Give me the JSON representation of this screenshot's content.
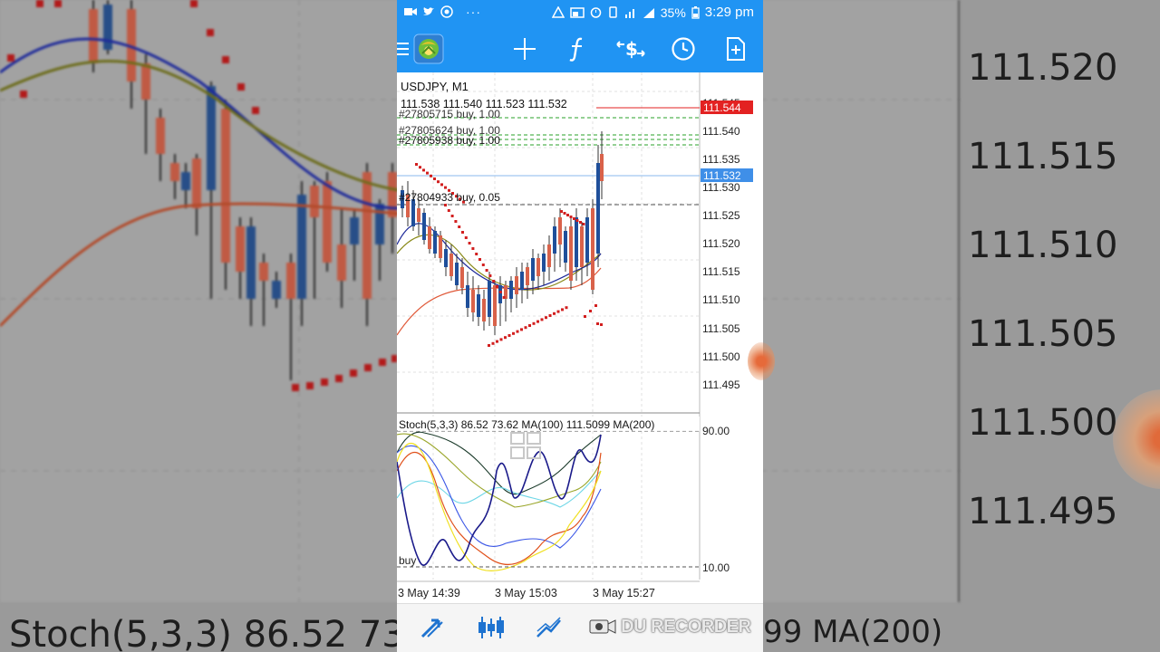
{
  "status_bar": {
    "time": "3:29 pm",
    "battery": "35%",
    "more": "···"
  },
  "toolbar": {
    "menu_icon": "hamburger-menu-icon",
    "app_icon": "metatrader-logo-icon",
    "buttons": [
      "crosshair-icon",
      "function-icon",
      "dollar-switch-icon",
      "clock-timeframe-icon",
      "new-order-icon"
    ]
  },
  "chart": {
    "symbol": "USDJPY, M1",
    "ohlc": "111.538 111.540 111.523 111.532",
    "orders": [
      "#27805715 buy, 1.00",
      "#27805624 buy, 1.00",
      "#27805938 buy, 1.00",
      "#27804933 buy, 0.05"
    ],
    "price_labels": [
      "111.545",
      "111.540",
      "111.535",
      "111.530",
      "111.525",
      "111.520",
      "111.515",
      "111.510",
      "111.505",
      "111.500",
      "111.495"
    ],
    "ask_price": "111.544",
    "bid_price": "111.532",
    "ask_color": "#e32222",
    "bid_color": "#3f8fe8",
    "stoch_header": "Stoch(5,3,3) 86.52 73.62 MA(100) 111.5099 MA(200)",
    "stoch_levels": [
      "90.00",
      "10.00"
    ],
    "stoch_order_tag": "buy",
    "time_labels": [
      "3 May 14:39",
      "3 May 15:03",
      "3 May 15:27"
    ]
  },
  "bottom_bar": {
    "buttons": [
      "trade-arrows-icon",
      "candles-icon",
      "indicators-icon"
    ],
    "watermark": "DU RECORDER"
  },
  "background": {
    "big_prices": [
      "111.520",
      "111.515",
      "111.510",
      "111.505",
      "111.500",
      "111.495"
    ],
    "big_stoch": "Stoch(5,3,3) 86.52 73",
    "big_ma": "99 MA(200)"
  },
  "colors": {
    "toolbar_blue": "#2094f3",
    "candle_bull": "#1f4f9a",
    "candle_bear": "#d9624a",
    "parabolic_sar": "#d21f1f"
  }
}
